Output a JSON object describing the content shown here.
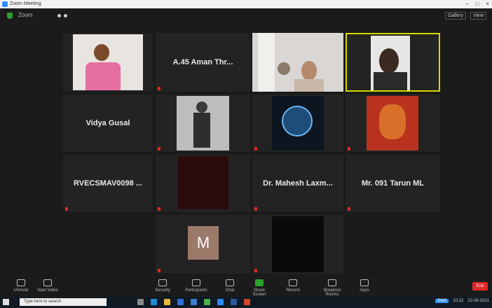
{
  "window": {
    "title": "Zoom Meeting"
  },
  "topbar": {
    "info_label": "Zoom"
  },
  "view": {
    "label": "View",
    "options_label": "Gallery"
  },
  "tiles": [
    {
      "id": "t1",
      "name": "",
      "label": "",
      "has_video": true,
      "photo": "person-pink-shirt",
      "muted": false
    },
    {
      "id": "t2",
      "name": "A.45 Aman Thr...",
      "label": "",
      "has_video": false,
      "muted": true
    },
    {
      "id": "t3",
      "name": "",
      "label": "",
      "has_video": true,
      "photo": "woman-room",
      "muted": false
    },
    {
      "id": "t4",
      "name": "",
      "label": "",
      "has_video": true,
      "photo": "man-dark",
      "muted": false,
      "active_speaker": true
    },
    {
      "id": "t5",
      "name": "Vidya Gusal",
      "label": "",
      "has_video": false,
      "muted": true
    },
    {
      "id": "t6",
      "name": "",
      "label": "",
      "has_video": true,
      "photo": "person-standing",
      "muted": true
    },
    {
      "id": "t7",
      "name": "",
      "label": "",
      "has_video": true,
      "photo": "logo-circle",
      "muted": true
    },
    {
      "id": "t8",
      "name": "",
      "label": "",
      "has_video": true,
      "photo": "red-deity",
      "muted": true
    },
    {
      "id": "t9",
      "name": "RVECSMAV0098 ...",
      "label": "",
      "has_video": false,
      "muted": true
    },
    {
      "id": "t10",
      "name": "",
      "label": "",
      "has_video": true,
      "photo": "dark-red",
      "muted": true
    },
    {
      "id": "t11",
      "name": "Dr. Mahesh Laxm...",
      "label": "",
      "has_video": false,
      "muted": true
    },
    {
      "id": "t12",
      "name": "Mr. 091 Tarun ML",
      "label": "",
      "has_video": false,
      "muted": true
    },
    {
      "id": "t13",
      "name": "",
      "label": "",
      "has_video": true,
      "avatar": "M",
      "muted": true
    },
    {
      "id": "t14",
      "name": "",
      "label": "",
      "has_video": true,
      "photo": "dark-video",
      "muted": true
    }
  ],
  "toolbar": {
    "mute_label": "Unmute",
    "video_label": "Start Video",
    "security_label": "Security",
    "participants_label": "Participants",
    "chat_label": "Chat",
    "share_label": "Share Screen",
    "record_label": "Record",
    "breakout_label": "Breakout Rooms",
    "apps_label": "Apps",
    "end_label": "End"
  },
  "taskbar": {
    "search_placeholder": "Type here to search",
    "lang": "ENG",
    "time": "10:22",
    "date": "22-09-2021"
  },
  "colors": {
    "active_speaker": "#d8d800",
    "muted": "#e02828",
    "share_green": "#2ca02c"
  }
}
